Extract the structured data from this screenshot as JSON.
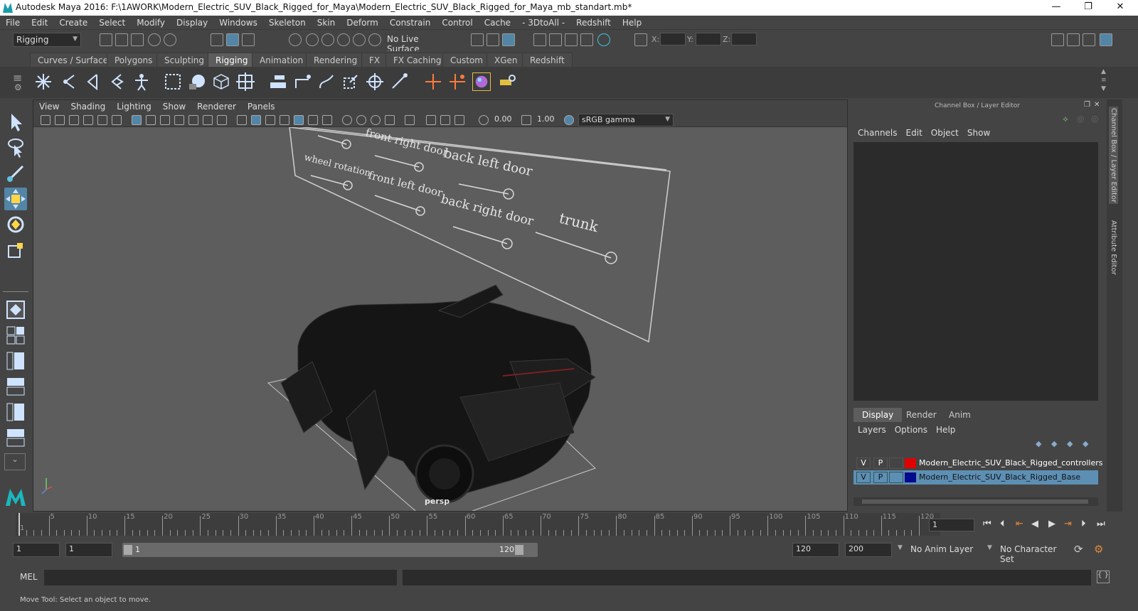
{
  "window": {
    "title": "Autodesk Maya 2016: F:\\1AWORK\\Modern_Electric_SUV_Black_Rigged_for_Maya\\Modern_Electric_SUV_Black_Rigged_for_Maya_mb_standart.mb*",
    "minimize": "—",
    "restore": "❐",
    "close": "✕"
  },
  "menubar": [
    "File",
    "Edit",
    "Create",
    "Select",
    "Modify",
    "Display",
    "Windows",
    "Skeleton",
    "Skin",
    "Deform",
    "Constrain",
    "Control",
    "Cache",
    "- 3DtoAll -",
    "Redshift",
    "Help"
  ],
  "statusline": {
    "menuset": "Rigging",
    "live_surface": "No Live Surface",
    "x_label": "X:",
    "y_label": "Y:",
    "z_label": "Z:"
  },
  "shelf_tabs": [
    "Curves / Surfaces",
    "Polygons",
    "Sculpting",
    "Rigging",
    "Animation",
    "Rendering",
    "FX",
    "FX Caching",
    "Custom",
    "XGen",
    "Redshift"
  ],
  "active_shelf": "Rigging",
  "viewport": {
    "menu": [
      "View",
      "Shading",
      "Lighting",
      "Show",
      "Renderer",
      "Panels"
    ],
    "exposure": "0.00",
    "gamma": "1.00",
    "colorspace": "sRGB gamma",
    "camera_label": "persp",
    "controls": {
      "wheel_rotation": "wheel rotation",
      "front_right_door": "front right door",
      "front_left_door": "front left door",
      "back_left_door": "back left door",
      "back_right_door": "back right door",
      "trunk": "trunk"
    }
  },
  "channelbox": {
    "header": "Channel Box / Layer Editor",
    "menu": [
      "Channels",
      "Edit",
      "Object",
      "Show"
    ],
    "layer_tabs": [
      "Display",
      "Render",
      "Anim"
    ],
    "layer_menu": [
      "Layers",
      "Options",
      "Help"
    ],
    "layers": [
      {
        "v": "V",
        "p": "P",
        "color": "#e00000",
        "name": "Modern_Electric_SUV_Black_Rigged_controllers",
        "selected": false
      },
      {
        "v": "V",
        "p": "P",
        "color": "#000a8c",
        "name": "Modern_Electric_SUV_Black_Rigged_Base",
        "selected": true
      }
    ]
  },
  "side_tabs": [
    "Channel Box / Layer Editor",
    "Attribute Editor"
  ],
  "timeline": {
    "ticks": [
      "5",
      "10",
      "15",
      "20",
      "25",
      "30",
      "35",
      "40",
      "45",
      "50",
      "55",
      "60",
      "65",
      "70",
      "75",
      "80",
      "85",
      "90",
      "95",
      "100",
      "105",
      "110",
      "115",
      "120"
    ],
    "first_tick": "1",
    "current_frame": "1"
  },
  "range": {
    "start": "1",
    "anim_start": "1",
    "slider_start": "1",
    "slider_end": "120",
    "end": "120",
    "anim_end": "200",
    "anim_layer": "No Anim Layer",
    "char_set": "No Character Set"
  },
  "mel": {
    "label": "MEL"
  },
  "status": {
    "help": "Move Tool: Select an object to move."
  },
  "colors": {
    "accent": "#5285a6",
    "selected_layer": "#5d8fb4",
    "viewport_bg": "#5d5d5d"
  }
}
